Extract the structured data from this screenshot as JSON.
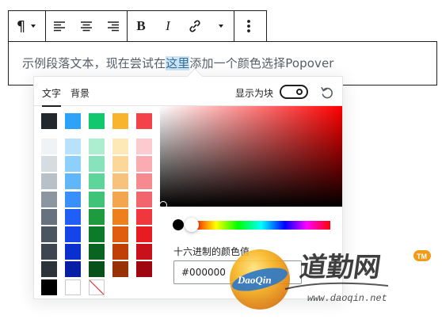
{
  "toolbar": {
    "paragraph_icon": "¶",
    "bold_label": "B",
    "italic_label": "I"
  },
  "editor": {
    "text_before": "示例段落文本，现在尝试在",
    "text_highlight": "这里",
    "text_after": "添加一个颜色选择Popover"
  },
  "popover": {
    "tab_text": "文字",
    "tab_background": "背景",
    "display_as_block_label": "显示为块",
    "display_as_block": false,
    "hex_label": "十六进制的颜色值",
    "hex_value": "#000000",
    "current_color": "#000000",
    "swatch_top_row": [
      "#23282d",
      "#2ea2f8",
      "#11c86f",
      "#f7b42c",
      "#f4424a"
    ],
    "swatch_columns": [
      [
        "#f0f3f6",
        "#d7dce0",
        "#b9c1c8",
        "#8b96a1",
        "#67727e",
        "#4b5560",
        "#3d4650",
        "#2c333a",
        "#000000"
      ],
      [
        "#b7e1fd",
        "#8dd0fc",
        "#5fb7f9",
        "#3a90fa",
        "#1f5ff6",
        "#1545e8",
        "#0a2fcf",
        "#061fa3",
        "#ffffff"
      ],
      [
        "#aeeed0",
        "#86e3bc",
        "#5ed59b",
        "#3fc378",
        "#1e9a3f",
        "#0b7b2a",
        "#086420",
        "#06521a",
        "none"
      ],
      [
        "#fde8b8",
        "#fbd79a",
        "#f7c27b",
        "#f2a64d",
        "#ed7f1d",
        "#e05c0f",
        "#bf3f05",
        "#963206",
        ""
      ],
      [
        "#fdcad0",
        "#fbabb2",
        "#f78991",
        "#f3656d",
        "#f0373d",
        "#e71c22",
        "#c8111a",
        "#a00610",
        ""
      ]
    ]
  },
  "watermark": {
    "brand": "道勤网",
    "badge": "DaoQin",
    "tm": "TM",
    "url": "www.daoqin.net"
  }
}
